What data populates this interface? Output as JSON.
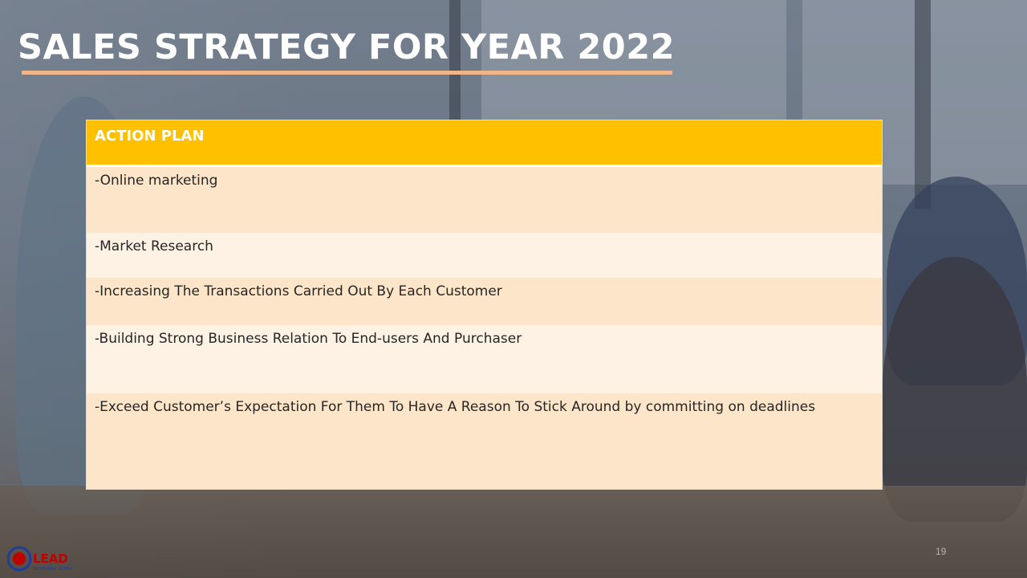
{
  "slide": {
    "title": "SALES STRATEGY FOR YEAR 2022",
    "slide_number": "19",
    "colors": {
      "title_underline": "#f2b58a",
      "header_bg": "#ffc000",
      "row_dark": "#fde5c9",
      "row_light": "#fef2e4"
    }
  },
  "action_plan": {
    "header": "ACTION PLAN",
    "rows": [
      "-Online marketing",
      "-Market Research",
      "-Increasing The Transactions Carried Out By Each Customer",
      "-Building Strong Business Relation To End-users And Purchaser",
      "-Exceed Customer’s Expectation For Them To Have A Reason To Stick Around by committing on deadlines"
    ]
  },
  "logo": {
    "wordmark": "LEAD",
    "subtext": "INDUSTRIAL SUPPLY"
  }
}
